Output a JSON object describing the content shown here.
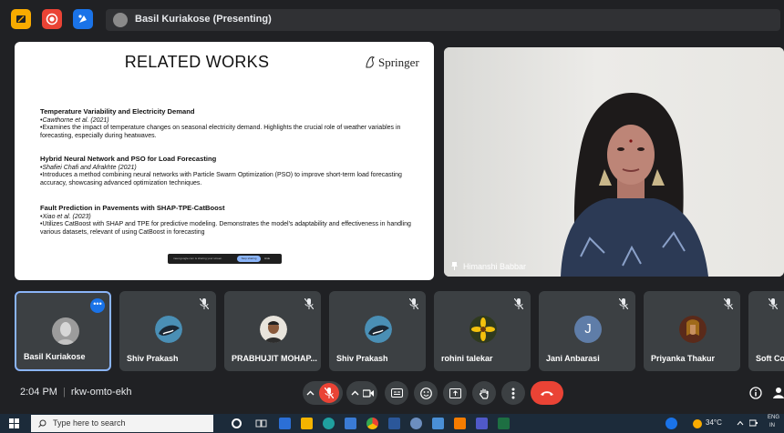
{
  "top_bar": {
    "presenter_text": "Basil Kuriakose (Presenting)",
    "icons": [
      "present-icon",
      "record-icon",
      "activities-icon",
      "presenter-avatar"
    ]
  },
  "slide": {
    "title": "RELATED WORKS",
    "publisher": "Springer",
    "sections": [
      {
        "heading": "Temperature Variability and Electricity Demand",
        "authors": "•Cawthorne et al. (2021)",
        "text": "•Examines the impact of temperature changes on seasonal electricity demand. Highlights the crucial role of weather variables in forecasting, especially during heatwaves."
      },
      {
        "heading": "Hybrid Neural Network and PSO for Load Forecasting",
        "authors": "•Shafiei Chafi and Afrakhte (2021)",
        "text": "•Introduces a method combining neural networks with Particle Swarm Optimization (PSO) to improve short-term load forecasting accuracy, showcasing advanced optimization techniques."
      },
      {
        "heading": "Fault Prediction in Pavements with SHAP-TPE-CatBoost",
        "authors": "•Xiao et al. (2023)",
        "text": "•Utilizes CatBoost with SHAP and TPE for predictive modeling. Demonstrates the model's adaptability and effectiveness in handling various datasets, relevant of using CatBoost  in forecasting"
      }
    ],
    "share_bar": {
      "message": "meet.google.com is sharing your screen.",
      "stop_label": "Stop sharing",
      "hide_label": "Hide"
    }
  },
  "speaker": {
    "name": "Himanshi Babbar"
  },
  "participants": [
    {
      "name": "Basil Kuriakose",
      "active": true,
      "muted": false,
      "avatar": "photo-gray"
    },
    {
      "name": "Shiv Prakash",
      "active": false,
      "muted": true,
      "avatar": "orca"
    },
    {
      "name": "PRABHUJIT MOHAP...",
      "active": false,
      "muted": true,
      "avatar": "man-photo"
    },
    {
      "name": "Shiv Prakash",
      "active": false,
      "muted": true,
      "avatar": "orca"
    },
    {
      "name": "rohini talekar",
      "active": false,
      "muted": true,
      "avatar": "flower"
    },
    {
      "name": "Jani Anbarasi",
      "active": false,
      "muted": true,
      "avatar": "J"
    },
    {
      "name": "Priyanka Thakur",
      "active": false,
      "muted": true,
      "avatar": "portrait"
    },
    {
      "name": "Soft Co",
      "active": false,
      "muted": true,
      "avatar": "none"
    }
  ],
  "call_bar": {
    "time": "2:04 PM",
    "meeting_code": "rkw-omto-ekh"
  },
  "taskbar": {
    "search_placeholder": "Type here to search",
    "temperature": "34°C",
    "lang": "ENG",
    "lang2": "IN"
  },
  "colors": {
    "accent": "#8ab4f8",
    "danger": "#ea4335",
    "surface": "#3c4043",
    "background": "#202124"
  }
}
